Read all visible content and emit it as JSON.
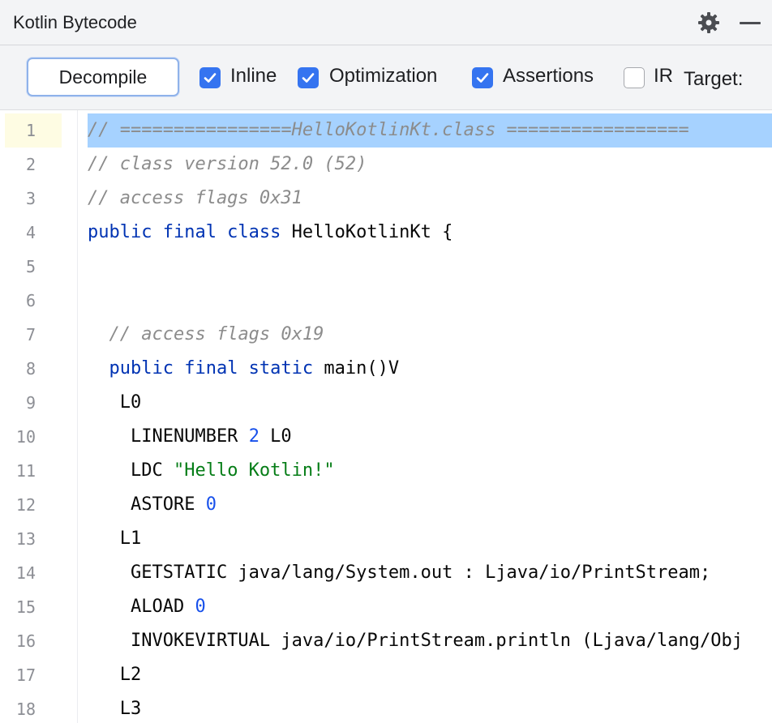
{
  "panel": {
    "title": "Kotlin Bytecode"
  },
  "toolbar": {
    "decompile_label": "Decompile",
    "inline_label": "Inline",
    "inline_checked": true,
    "optimization_label": "Optimization",
    "optimization_checked": true,
    "assertions_label": "Assertions",
    "assertions_checked": true,
    "ir_label": "IR",
    "ir_checked": false,
    "target_label": "Target:"
  },
  "colors": {
    "accent": "#3574f0",
    "selection": "#a6d2ff",
    "keyword": "#0033b3",
    "number": "#1750eb",
    "string": "#067d17",
    "comment": "#8c8c8c"
  },
  "editor": {
    "current_line": 1,
    "lines": [
      {
        "n": "1",
        "tokens": [
          {
            "t": "// ================HelloKotlinKt.class =================",
            "c": "c"
          }
        ]
      },
      {
        "n": "2",
        "tokens": [
          {
            "t": "// class version 52.0 (52)",
            "c": "c"
          }
        ]
      },
      {
        "n": "3",
        "tokens": [
          {
            "t": "// access flags 0x31",
            "c": "c"
          }
        ]
      },
      {
        "n": "4",
        "tokens": [
          {
            "t": "public final class",
            "c": "k"
          },
          {
            "t": " HelloKotlinKt {",
            "c": ""
          }
        ]
      },
      {
        "n": "5",
        "tokens": []
      },
      {
        "n": "6",
        "tokens": []
      },
      {
        "n": "7",
        "tokens": [
          {
            "t": "  ",
            "c": ""
          },
          {
            "t": "// access flags 0x19",
            "c": "c"
          }
        ]
      },
      {
        "n": "8",
        "tokens": [
          {
            "t": "  ",
            "c": ""
          },
          {
            "t": "public final static",
            "c": "k"
          },
          {
            "t": " main()V",
            "c": ""
          }
        ]
      },
      {
        "n": "9",
        "tokens": [
          {
            "t": "   L0",
            "c": ""
          }
        ]
      },
      {
        "n": "10",
        "tokens": [
          {
            "t": "    LINENUMBER ",
            "c": ""
          },
          {
            "t": "2",
            "c": "n"
          },
          {
            "t": " L0",
            "c": ""
          }
        ]
      },
      {
        "n": "11",
        "tokens": [
          {
            "t": "    LDC ",
            "c": ""
          },
          {
            "t": "\"Hello Kotlin!\"",
            "c": "s"
          }
        ]
      },
      {
        "n": "12",
        "tokens": [
          {
            "t": "    ASTORE ",
            "c": ""
          },
          {
            "t": "0",
            "c": "n"
          }
        ]
      },
      {
        "n": "13",
        "tokens": [
          {
            "t": "   L1",
            "c": ""
          }
        ]
      },
      {
        "n": "14",
        "tokens": [
          {
            "t": "    GETSTATIC java/lang/System.out : Ljava/io/PrintStream;",
            "c": ""
          }
        ]
      },
      {
        "n": "15",
        "tokens": [
          {
            "t": "    ALOAD ",
            "c": ""
          },
          {
            "t": "0",
            "c": "n"
          }
        ]
      },
      {
        "n": "16",
        "tokens": [
          {
            "t": "    INVOKEVIRTUAL java/io/PrintStream.println (Ljava/lang/Obj",
            "c": ""
          }
        ]
      },
      {
        "n": "17",
        "tokens": [
          {
            "t": "   L2",
            "c": ""
          }
        ]
      },
      {
        "n": "18",
        "tokens": [
          {
            "t": "   L3",
            "c": ""
          }
        ]
      }
    ]
  }
}
